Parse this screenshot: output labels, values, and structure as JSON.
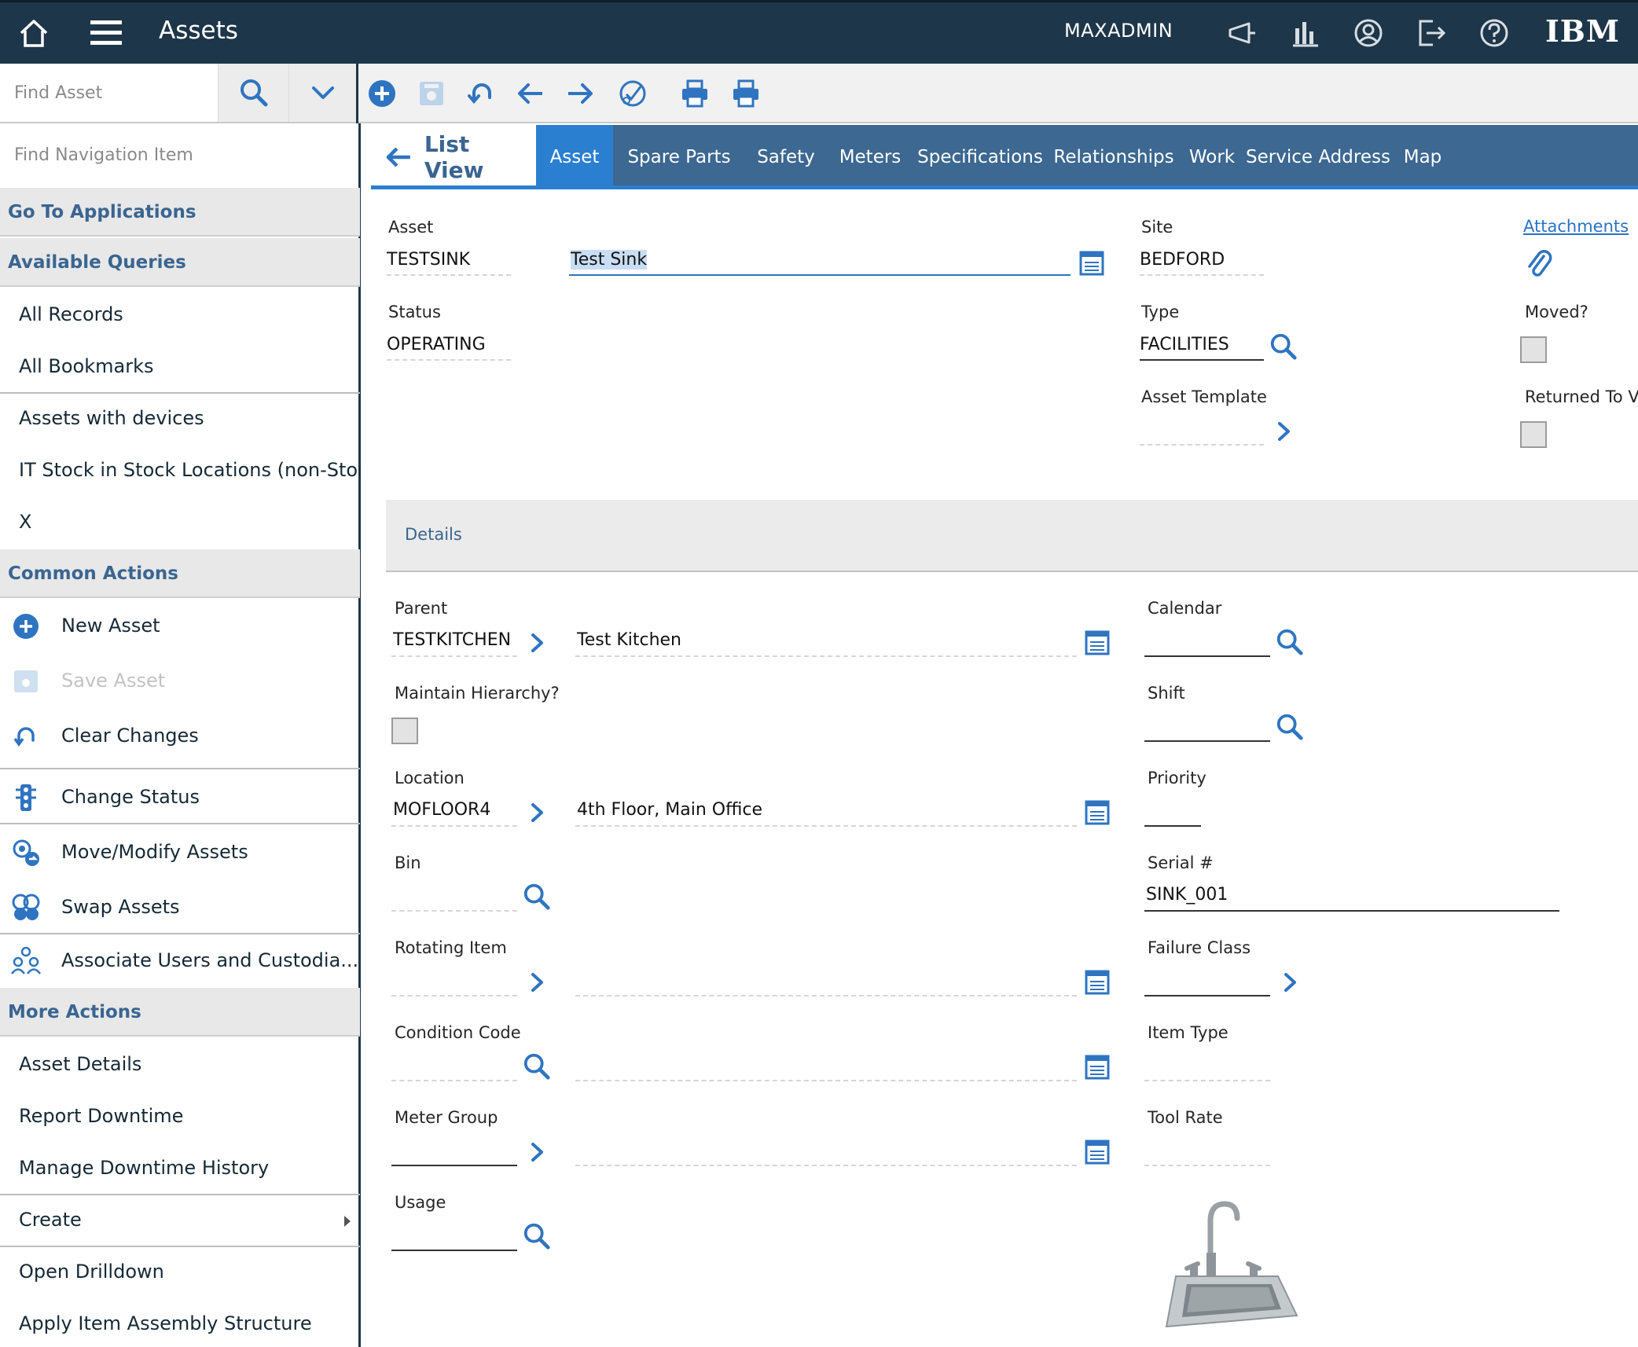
{
  "app": {
    "title": "Assets",
    "user": "MAXADMIN",
    "brand": "IBM"
  },
  "toolbar": {
    "find_placeholder": "Find Asset",
    "icons": [
      "add-icon",
      "save-icon",
      "undo-icon",
      "back-icon",
      "forward-icon",
      "status-icon",
      "print-icon",
      "print-icon"
    ]
  },
  "sidebar": {
    "search_placeholder": "Find Navigation Item",
    "go_to_applications": "Go To Applications",
    "available_queries": "Available Queries",
    "queries": [
      "All Records",
      "All Bookmarks",
      "Assets with devices",
      "IT Stock in Stock Locations (non-Stor...",
      "X"
    ],
    "common_actions": "Common Actions",
    "actions": [
      "New Asset",
      "Save Asset",
      "Clear Changes",
      "Change Status",
      "Move/Modify Assets",
      "Swap Assets",
      "Associate Users and Custodia..."
    ],
    "more_actions": "More Actions",
    "more": [
      "Asset Details",
      "Report Downtime",
      "Manage Downtime History",
      "Create",
      "Open Drilldown",
      "Apply Item Assembly Structure"
    ]
  },
  "tabs": {
    "list_view": "List View",
    "items": [
      "Asset",
      "Spare Parts",
      "Safety",
      "Meters",
      "Specifications",
      "Relationships",
      "Work",
      "Service Address",
      "Map"
    ],
    "active": "Asset"
  },
  "header": {
    "asset_label": "Asset",
    "asset_value": "TESTSINK",
    "description": "Test Sink",
    "site_label": "Site",
    "site_value": "BEDFORD",
    "attachments": "Attachments",
    "status_label": "Status",
    "status_value": "OPERATING",
    "type_label": "Type",
    "type_value": "FACILITIES",
    "moved_label": "Moved?",
    "template_label": "Asset Template",
    "template_value": "",
    "returned_label": "Returned To Ve"
  },
  "details": {
    "section_title": "Details",
    "parent_label": "Parent",
    "parent_value": "TESTKITCHEN",
    "parent_desc": "Test Kitchen",
    "calendar_label": "Calendar",
    "calendar_value": "",
    "maintain_label": "Maintain Hierarchy?",
    "shift_label": "Shift",
    "shift_value": "",
    "location_label": "Location",
    "location_value": "MOFLOOR4",
    "location_desc": "4th Floor, Main Office",
    "priority_label": "Priority",
    "priority_value": "",
    "bin_label": "Bin",
    "bin_value": "",
    "serial_label": "Serial #",
    "serial_value": "SINK_001",
    "rotating_label": "Rotating Item",
    "rotating_value": "",
    "failure_label": "Failure Class",
    "failure_value": "",
    "condition_label": "Condition Code",
    "condition_value": "",
    "itemtype_label": "Item Type",
    "itemtype_value": "",
    "metergroup_label": "Meter Group",
    "metergroup_value": "",
    "toolrate_label": "Tool Rate",
    "toolrate_value": "",
    "usage_label": "Usage",
    "usage_value": ""
  },
  "colors": {
    "topbar": "#1d3649",
    "accent": "#2a7fd1",
    "tabbar": "#3c6891",
    "link": "#3a6591"
  }
}
